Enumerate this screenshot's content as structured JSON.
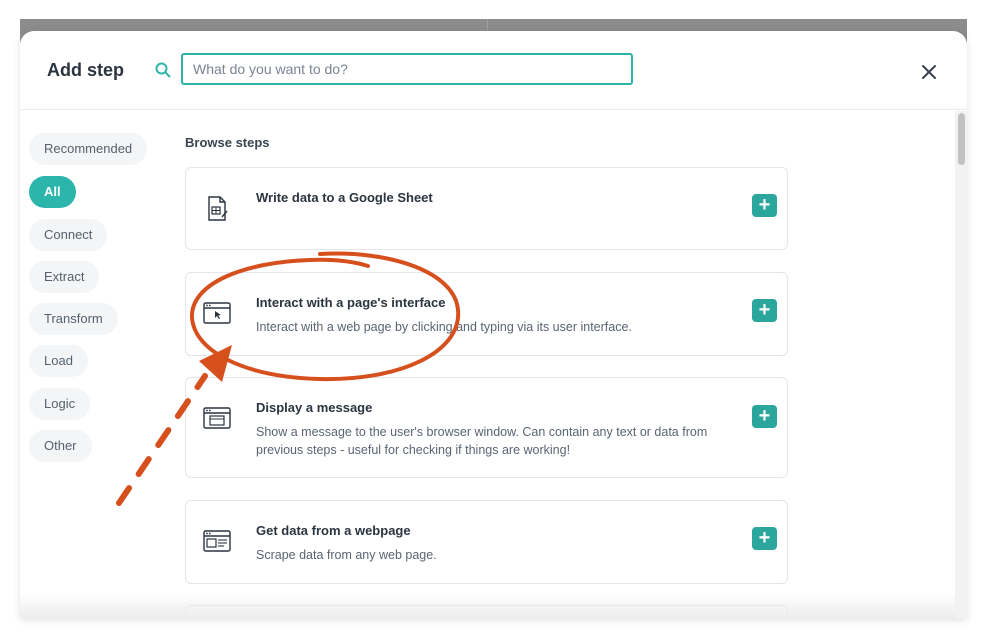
{
  "dialog": {
    "title": "Add step",
    "search": {
      "placeholder": "What do you want to do?",
      "value": ""
    }
  },
  "sidebar": {
    "items": [
      {
        "label": "Recommended",
        "active": false
      },
      {
        "label": "All",
        "active": true
      },
      {
        "label": "Connect",
        "active": false
      },
      {
        "label": "Extract",
        "active": false
      },
      {
        "label": "Transform",
        "active": false
      },
      {
        "label": "Load",
        "active": false
      },
      {
        "label": "Logic",
        "active": false
      },
      {
        "label": "Other",
        "active": false
      }
    ]
  },
  "content": {
    "heading": "Browse steps",
    "steps": [
      {
        "title": "Write data to a Google Sheet",
        "description": "",
        "icon": "spreadsheet-icon"
      },
      {
        "title": "Interact with a page's interface",
        "description": "Interact with a web page by clicking and typing via its user interface.",
        "icon": "browser-cursor-icon"
      },
      {
        "title": "Display a message",
        "description": "Show a message to the user's browser window. Can contain any text or data from previous steps - useful for checking if things are working!",
        "icon": "browser-message-icon"
      },
      {
        "title": "Get data from a webpage",
        "description": "Scrape data from any web page.",
        "icon": "browser-scrape-icon"
      }
    ],
    "add_label": "+"
  },
  "annotation": {
    "color": "#d6501e"
  },
  "theme": {
    "accent": "#2cb5aa",
    "button": "#2aa69c"
  }
}
